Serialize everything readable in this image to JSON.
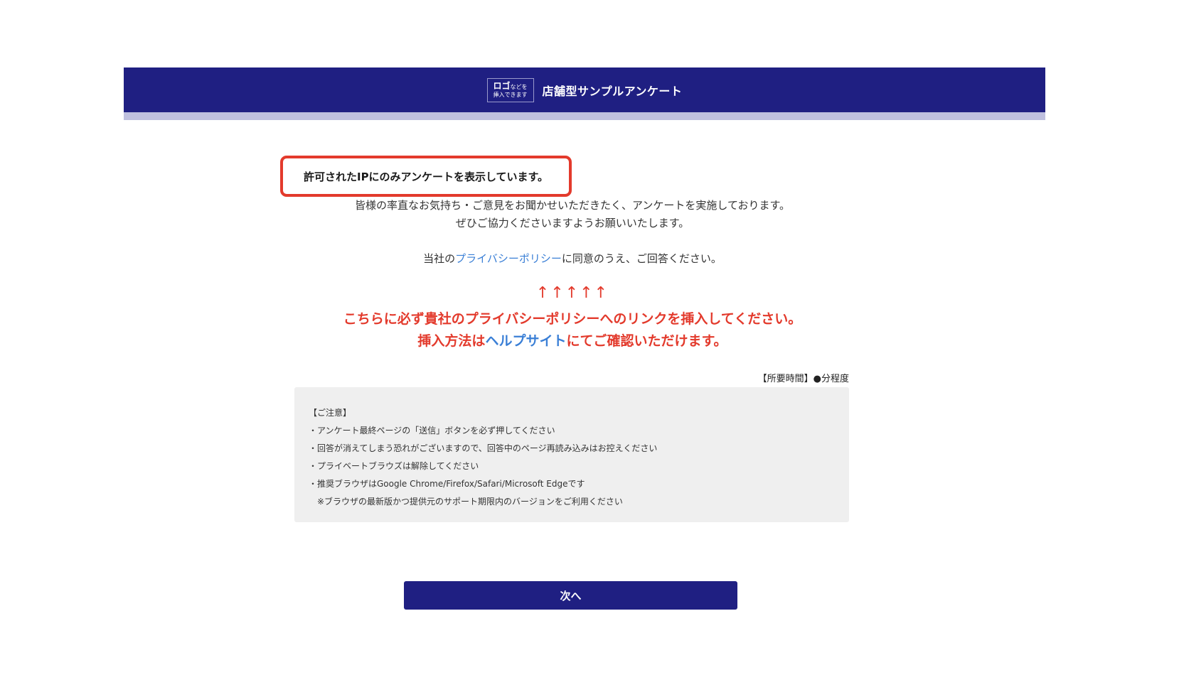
{
  "header": {
    "logo_line1": "ロゴ",
    "logo_line1_small": "などを",
    "logo_line2": "挿入できます",
    "title": "店舗型サンプルアンケート",
    "bg_color": "#1f1f82",
    "strip_color": "#bfc0df"
  },
  "ip_notice": "許可されたIPにのみアンケートを表示しています。",
  "intro": {
    "line1": "皆様の率直なお気持ち・ご意見をお聞かせいただきたく、アンケートを実施しております。",
    "line2": "ぜひご協力くださいますようお願いいたします。",
    "privacy_prefix": "当社の",
    "privacy_link": "プライバシーポリシー",
    "privacy_suffix": "に同意のうえ、ご回答ください。"
  },
  "annotation": {
    "arrows": "↑↑↑↑↑",
    "line1": "こちらに必ず貴社のプライバシーポリシーへのリンクを挿入してください。",
    "line2_prefix": "挿入方法は",
    "line2_link": "ヘルプサイト",
    "line2_suffix": "にてご確認いただけます。",
    "color": "#e33a2c"
  },
  "time_needed": "【所要時間】●分程度",
  "caution": {
    "title": "【ご注意】",
    "items": [
      "・アンケート最終ページの「送信」ボタンを必ず押してください",
      "・回答が消えてしまう恐れがございますので、回答中のページ再読み込みはお控えください",
      "・プライベートブラウズは解除してください",
      "・推奨ブラウザはGoogle Chrome/Firefox/Safari/Microsoft Edgeです",
      "　※ブラウザの最新版かつ提供元のサポート期限内のバージョンをご利用ください"
    ]
  },
  "next_button": "次へ",
  "link_color": "#3a7fd6"
}
